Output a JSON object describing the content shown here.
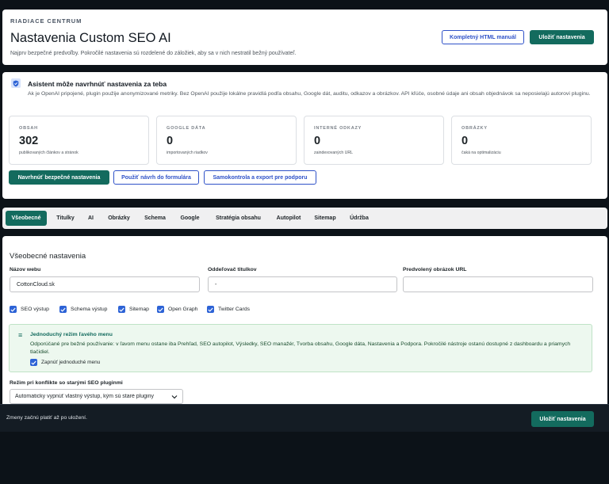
{
  "header": {
    "eyebrow": "RIADIACE CENTRUM",
    "title": "Nastavenia Custom SEO AI",
    "subtitle": "Najprv bezpečné predvoľby. Pokročilé nastavenia sú rozdelené do záložiek, aby sa v nich nestratil bežný používateľ.",
    "manual_button": "Kompletný HTML manuál",
    "save_button": "Uložiť nastavenia"
  },
  "assistant": {
    "icon": "shield-check-icon",
    "title": "Asistent môže navrhnúť nastavenia za teba",
    "description": "Ak je OpenAI pripojené, plugin použije anonymizované metriky. Bez OpenAI použije lokálne pravidlá podľa obsahu, Google dát, auditu, odkazov a obrázkov. API kľúče, osobné údaje ani obsah objednávok sa neposielajú autorovi pluginu.",
    "stats": [
      {
        "label": "OBSAH",
        "value": "302",
        "caption": "publikovaných článkov a stránok"
      },
      {
        "label": "GOOGLE DÁTA",
        "value": "0",
        "caption": "importovaných riadkov"
      },
      {
        "label": "INTERNÉ ODKAZY",
        "value": "0",
        "caption": "zaindexovaných URL"
      },
      {
        "label": "OBRÁZKY",
        "value": "0",
        "caption": "čaká na optimalizáciu"
      }
    ],
    "actions": {
      "suggest": "Navrhnúť bezpečné nastavenia",
      "apply": "Použiť návrh do formulára",
      "selfcheck": "Samokontrola a export pre podporu"
    }
  },
  "tabs": [
    "Všeobecné",
    "Titulky",
    "AI",
    "Obrázky",
    "Schema",
    "Google",
    "Stratégia obsahu",
    "Autopilot",
    "Sitemap",
    "Údržba"
  ],
  "active_tab": "Všeobecné",
  "general": {
    "section_title": "Všeobecné nastavenia",
    "site_name_label": "Názov webu",
    "site_name_value": "CottonCloud.sk",
    "separator_label": "Oddeľovač titulkov",
    "separator_value": "-",
    "default_image_label": "Predvolený obrázok URL",
    "default_image_value": "",
    "checkboxes": [
      "SEO výstup",
      "Schema výstup",
      "Sitemap",
      "Open Graph",
      "Twitter Cards"
    ],
    "simple_menu": {
      "title": "Jednoduchý režim ľavého menu",
      "body": "Odporúčané pre bežné používanie: v ľavom menu ostane iba Prehľad, SEO autopilot, Výsledky, SEO manažér, Tvorba obsahu, Google dáta, Nastavenia a Podpora. Pokročilé nástroje ostanú dostupné z dashboardu a priamych tlačidiel.",
      "checkbox": "Zapnúť jednoduché menu"
    },
    "conflict_label": "Režim pri konflikte so starými SEO pluginmi",
    "conflict_value": "Automaticky vypnúť vlastný výstup, kým sú staré pluginy"
  },
  "footer": {
    "note": "Zmeny začnú platiť až po uložení.",
    "save_button": "Uložiť nastavenia"
  },
  "colors": {
    "primary": "#136b5e",
    "accent_blue": "#2f52c8",
    "checkbox_blue": "#2d63d6",
    "page_bg": "#0c1218",
    "notice_bg": "#edf8ef"
  }
}
